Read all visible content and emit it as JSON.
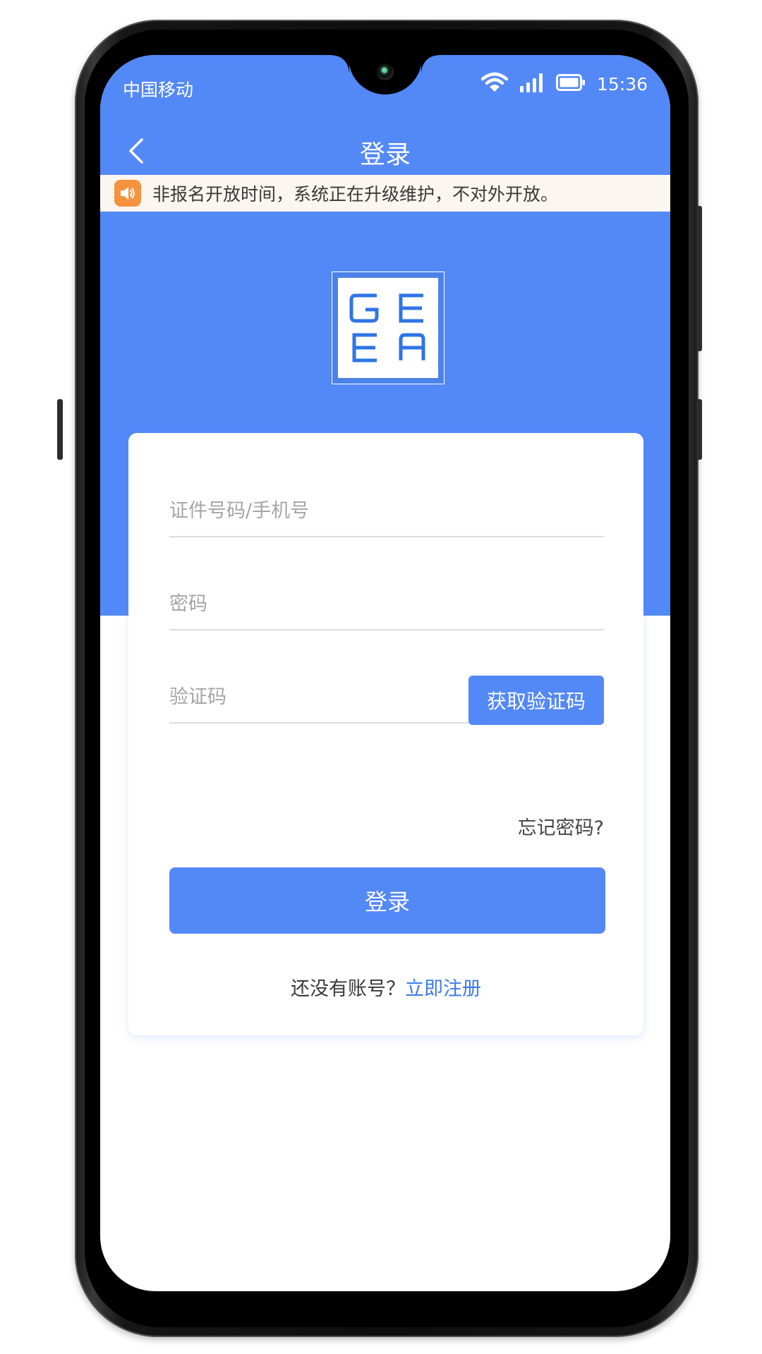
{
  "status_bar": {
    "carrier": "中国移动",
    "time": "15:36",
    "icons": [
      "wifi-icon",
      "signal-icon",
      "battery-icon"
    ]
  },
  "nav": {
    "title": "登录",
    "back_icon": "chevron-left-icon"
  },
  "notice": {
    "icon": "speaker-icon",
    "text": "非报名开放时间，系统正在升级维护，不对外开放。"
  },
  "logo": {
    "letters_top": "GE",
    "letters_bottom": "EA"
  },
  "form": {
    "id_placeholder": "证件号码/手机号",
    "id_value": "",
    "password_placeholder": "密码",
    "password_value": "",
    "code_placeholder": "验证码",
    "code_value": "",
    "get_code_label": "获取验证码",
    "forgot_label": "忘记密码?",
    "login_label": "登录",
    "no_account_text": "还没有账号？",
    "register_label": "立即注册"
  },
  "colors": {
    "primary": "#5388f7",
    "notice_bg": "#fbf6ef",
    "notice_icon": "#f5923e",
    "link": "#3d79ea"
  }
}
